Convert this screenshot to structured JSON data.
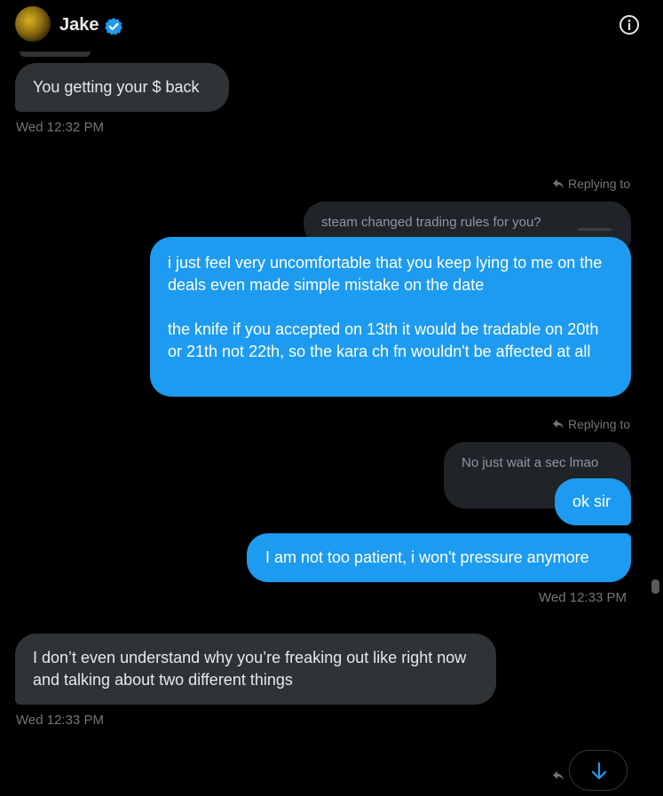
{
  "header": {
    "contact_name": "Jake",
    "verified": true,
    "avatar_icon": "avatar-image",
    "info_icon": "info-icon"
  },
  "messages": {
    "m1_text": "You getting your $ back",
    "m1_time": "Wed 12:32 PM",
    "replying_label_1": "Replying to",
    "quote_1": "steam changed trading rules for you?",
    "m2_p1": "i just feel very uncomfortable that you keep lying to me on the deals even made simple mistake on the date",
    "m2_p2": "the knife if you accepted on 13th it would be tradable on 20th or 21th not 22th, so the kara ch fn wouldn't be affected at all",
    "replying_label_2": "Replying to",
    "quote_2": "No just wait a sec lmao",
    "m3_text": "ok sir",
    "m4_text": "I am not too patient, i won't pressure anymore",
    "m4_time": "Wed 12:33 PM",
    "m5_text": "I don’t even understand why you’re freaking out like right now and talking about two different things",
    "m5_time": "Wed 12:33 PM"
  },
  "colors": {
    "background": "#000000",
    "incoming_bubble": "#2f3336",
    "outgoing_bubble": "#1d9bf0",
    "quote_bubble": "#202327",
    "muted_text": "#71767b",
    "verified_badge": "#1d9bf0"
  },
  "scroll_down_icon": "arrow-down-icon"
}
